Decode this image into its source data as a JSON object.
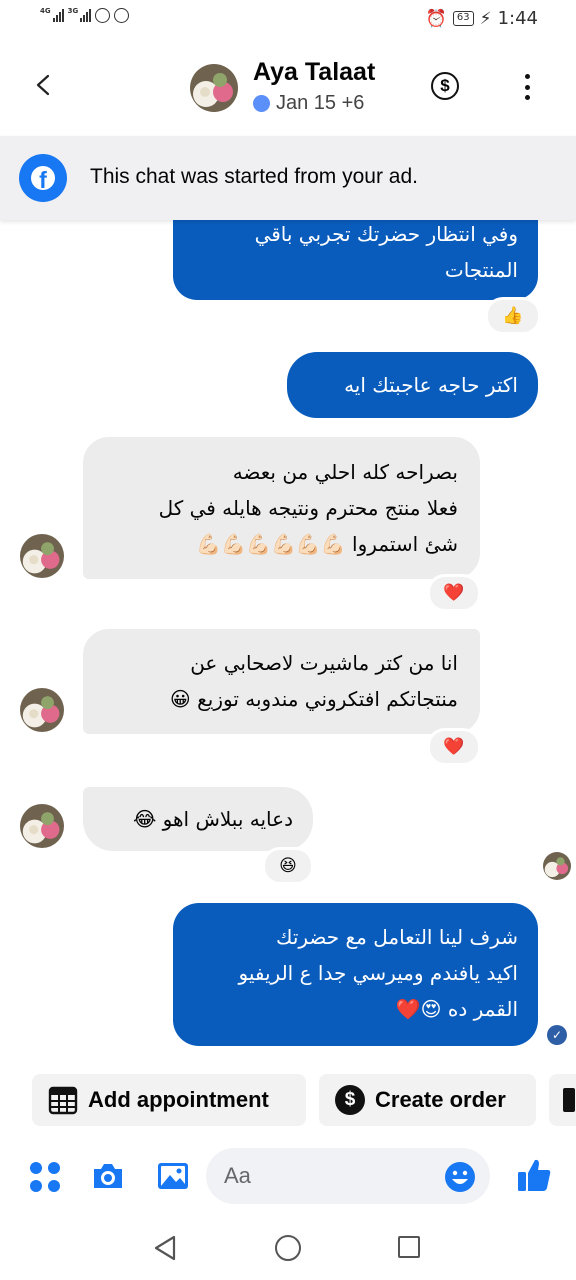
{
  "status_bar": {
    "net1": "4G",
    "net2": "3G",
    "battery": "63",
    "time": "1:44"
  },
  "header": {
    "contact_name": "Aya Talaat",
    "last_active": "Jan 15 +6"
  },
  "banner": {
    "text": "This chat was started from your ad."
  },
  "messages": [
    {
      "direction": "outgoing",
      "text": "وفي انتظار حضرتك تجربي باقي\nالمنتجات",
      "reaction": "👍"
    },
    {
      "direction": "outgoing",
      "text": "اكتر حاجه عاجبتك ايه"
    },
    {
      "direction": "incoming",
      "text": "بصراحه كله احلي من بعضه\nفعلا منتج محترم ونتيجه هايله في كل\nشئ  استمروا 💪🏻💪🏻💪🏻💪🏻💪🏻💪🏻",
      "reaction": "❤️"
    },
    {
      "direction": "incoming",
      "text": "انا من كتر ماشيرت لاصحابي عن\nمنتجاتكم افتكروني مندوبه توزيع 😀",
      "reaction": "❤️"
    },
    {
      "direction": "incoming",
      "text": "دعايه ببلاش اهو 😂",
      "reaction": "😆"
    },
    {
      "direction": "outgoing",
      "text": "شرف لينا التعامل مع حضرتك\nاكيد يافندم وميرسي جدا ع الريفيو\nالقمر ده 😍❤️"
    }
  ],
  "actions": {
    "add_appointment": "Add appointment",
    "create_order": "Create order"
  },
  "composer": {
    "placeholder": "Aa"
  },
  "icons": {
    "header": [
      "back-arrow-icon",
      "dollar-icon",
      "more-icon"
    ],
    "composer": [
      "apps-icon",
      "camera-icon",
      "gallery-icon",
      "emoji-icon",
      "like-icon"
    ],
    "nav": [
      "nav-back-icon",
      "nav-home-icon",
      "nav-recents-icon"
    ]
  },
  "colors": {
    "accent": "#1877f2",
    "outgoing_bubble": "#0a5cbc",
    "incoming_bubble": "#ececec",
    "banner_bg": "#f0f0f2"
  }
}
